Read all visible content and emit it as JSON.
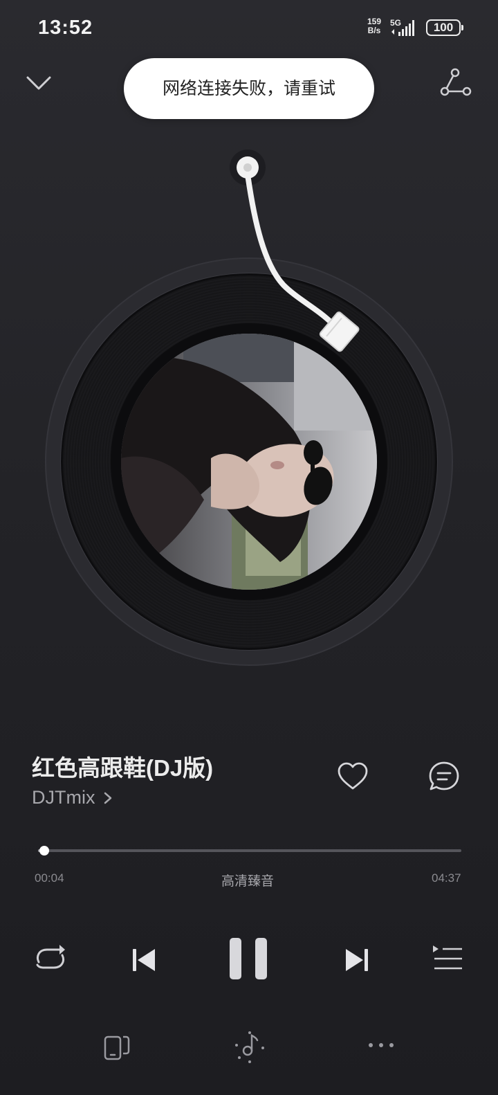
{
  "status_bar": {
    "time": "13:52",
    "net_speed_value": "159",
    "net_speed_unit": "B/s",
    "network": "5G",
    "battery": "100"
  },
  "toast": {
    "message": "网络连接失败，请重试"
  },
  "song": {
    "title": "红色高跟鞋(DJ版)",
    "artist": "DJTmix"
  },
  "progress": {
    "current": "00:04",
    "total": "04:37",
    "fraction": 0.014,
    "quality_label": "高清臻音"
  },
  "icons": {
    "collapse": "chevron-down-icon",
    "share": "share-icon",
    "like": "heart-icon",
    "comment": "comment-icon",
    "repeat": "repeat-icon",
    "prev": "previous-icon",
    "pause": "pause-icon",
    "next": "next-icon",
    "playlist": "playlist-icon",
    "device": "device-icon",
    "effect": "sound-effect-icon",
    "more": "more-icon"
  },
  "colors": {
    "background": "#232327",
    "toast_bg": "#ffffff",
    "accent": "#ffffff",
    "muted_text": "#a8a8ad"
  }
}
